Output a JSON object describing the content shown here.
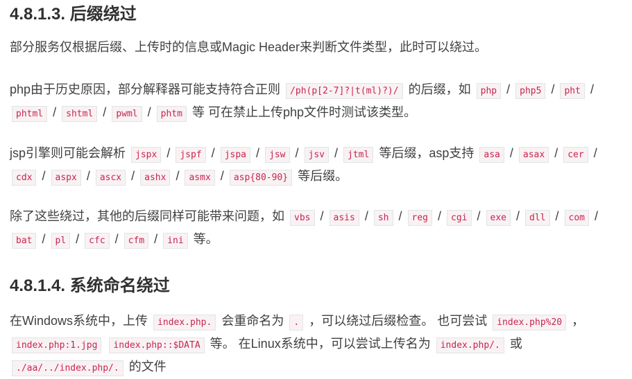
{
  "sections": [
    {
      "heading": "4.8.1.3. 后缀绕过",
      "p1": "部分服务仅根据后缀、上传时的信息或Magic Header来判断文件类型，此时可以绕过。",
      "p2": {
        "t1": "php由于历史原因，部分解释器可能支持符合正则",
        "regex": "/ph(p[2-7]?|t(ml)?)/",
        "t2": "的后缀，如",
        "exts": [
          "php",
          "php5",
          "pht",
          "phtml",
          "shtml",
          "pwml",
          "phtm"
        ],
        "t3": "等 可在禁止上传php文件时测试该类型。"
      },
      "p3": {
        "t1": "jsp引擎则可能会解析",
        "jsp_exts": [
          "jspx",
          "jspf",
          "jspa",
          "jsw",
          "jsv",
          "jtml"
        ],
        "t2": "等后缀，asp支持",
        "asp_exts": [
          "asa",
          "asax",
          "cer",
          "cdx",
          "aspx",
          "ascx",
          "ashx",
          "asmx",
          "asp{80-90}"
        ],
        "t3": "等后缀。"
      },
      "p4": {
        "t1": "除了这些绕过，其他的后缀同样可能带来问题，如",
        "exts": [
          "vbs",
          "asis",
          "sh",
          "reg",
          "cgi",
          "exe",
          "dll",
          "com",
          "bat",
          "pl",
          "cfc",
          "cfm",
          "ini"
        ],
        "t2": "等。"
      }
    },
    {
      "heading": "4.8.1.4. 系统命名绕过",
      "p1": {
        "t1": "在Windows系统中，上传",
        "c1": "index.php.",
        "t2": "会重命名为",
        "c2": ".",
        "t3": "，可以绕过后缀检查。 也可尝试",
        "c3": "index.php%20",
        "t4": "，",
        "c4": "index.php:1.jpg",
        "c5": "index.php::$DATA",
        "t5": "等。 在Linux系统中，可以尝试上传名为",
        "c6": "index.php/.",
        "t6": "或",
        "c7": "./aa/../index.php/.",
        "t7": "的文件"
      }
    }
  ]
}
